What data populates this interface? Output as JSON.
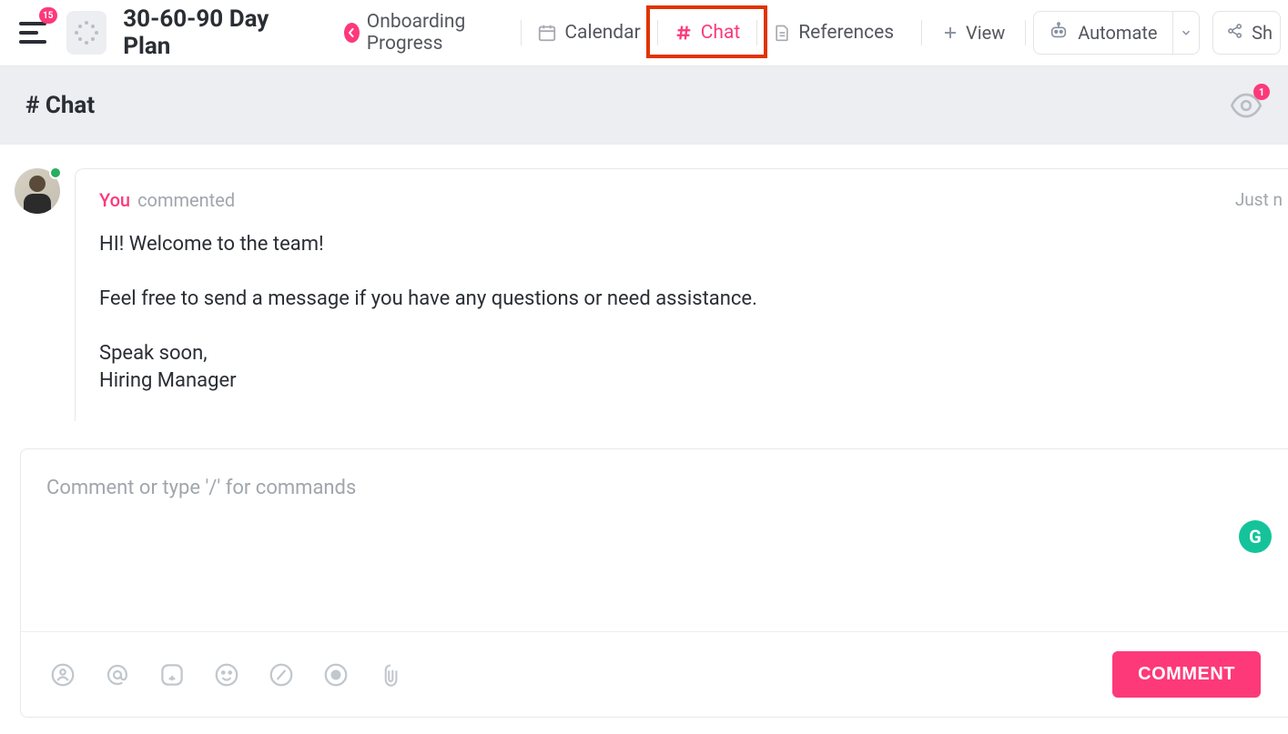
{
  "header": {
    "menu_badge": "15",
    "title": "30-60-90 Day Plan",
    "tabs": [
      {
        "label": "Onboarding Progress",
        "icon": "back"
      },
      {
        "label": "Calendar",
        "icon": "calendar"
      },
      {
        "label": "Chat",
        "icon": "hash",
        "active": true
      },
      {
        "label": "References",
        "icon": "doc"
      }
    ],
    "view_label": "View",
    "automate_label": "Automate",
    "share_label": "Sh"
  },
  "subheader": {
    "title": "# Chat",
    "watchers": "1"
  },
  "message": {
    "author": "You",
    "action": "commented",
    "time": "Just n",
    "body": "HI! Welcome to the team!\n\nFeel free to send a message if you have any questions or need assistance.\n\nSpeak soon,\nHiring Manager"
  },
  "composer": {
    "placeholder": "Comment or type '/' for commands",
    "submit_label": "COMMENT",
    "grammarly": "G"
  }
}
